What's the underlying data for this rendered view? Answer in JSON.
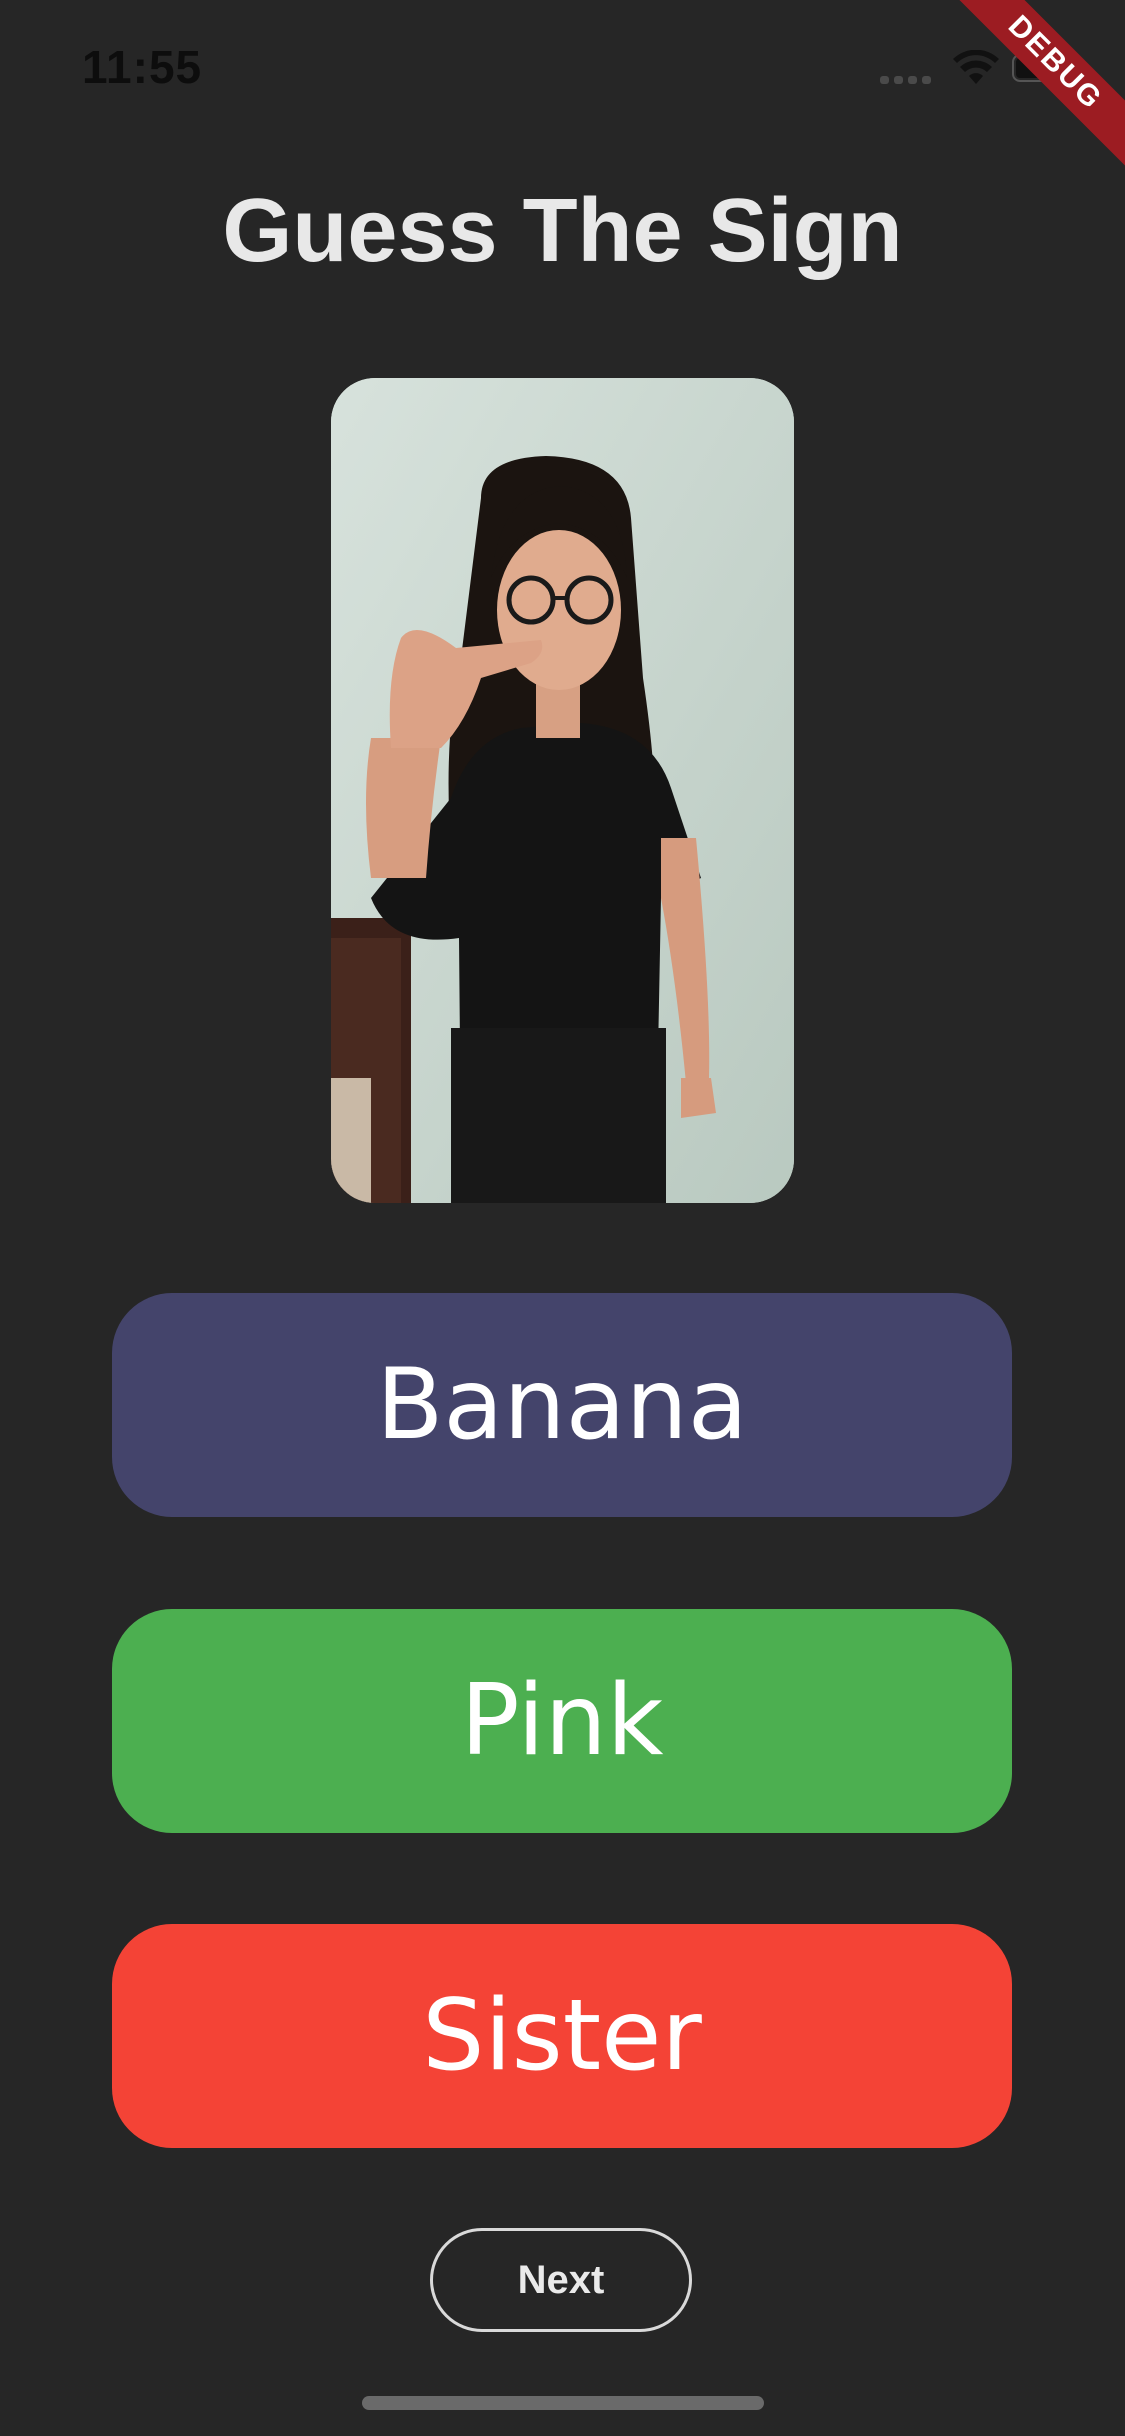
{
  "status_bar": {
    "time": "11:55"
  },
  "debug_banner": {
    "label": "DEBUG"
  },
  "header": {
    "title": "Guess The Sign"
  },
  "video": {
    "icon": "sign-video-frame"
  },
  "options": [
    {
      "label": "Banana",
      "color": "#44446b"
    },
    {
      "label": "Pink",
      "color": "#4caf50"
    },
    {
      "label": "Sister",
      "color": "#f44336"
    }
  ],
  "next": {
    "label": "Next"
  },
  "colors": {
    "background": "#262626",
    "title": "#e8e8e8",
    "debug": "#9c1c22"
  }
}
